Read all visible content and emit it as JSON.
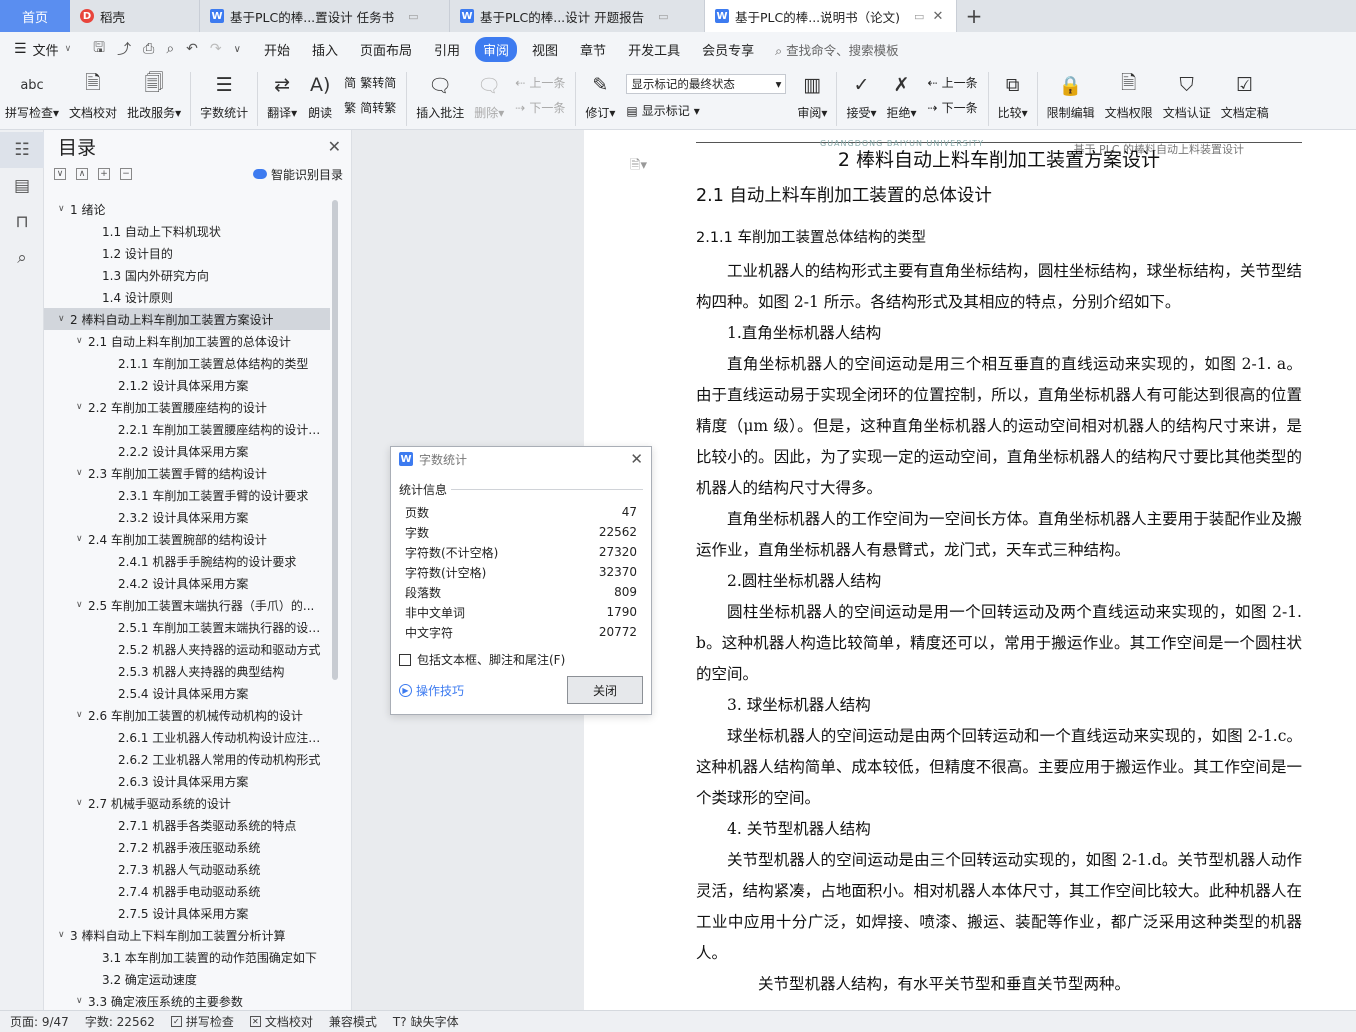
{
  "tabs": {
    "home": "首页",
    "items": [
      {
        "icon": "daoke-logo",
        "label": "稻壳"
      },
      {
        "icon": "wps-writer-logo",
        "label": "基于PLC的棒...置设计 任务书"
      },
      {
        "icon": "wps-writer-logo",
        "label": "基于PLC的棒...设计 开题报告"
      },
      {
        "icon": "wps-writer-logo",
        "label": "基于PLC的棒...说明书（论文)"
      }
    ]
  },
  "menu": {
    "file": "文件",
    "items": [
      "开始",
      "插入",
      "页面布局",
      "引用",
      "审阅",
      "视图",
      "章节",
      "开发工具",
      "会员专享"
    ],
    "active": "审阅",
    "search": "查找命令、搜索模板"
  },
  "ribbon": {
    "spell_ic": "abc",
    "spell": "拼写检查",
    "proofread": "文档校对",
    "batch": "批改服务",
    "wordcount": "字数统计",
    "translate": "翻译",
    "read": "朗读",
    "trad": "繁转简",
    "simp": "简转繁",
    "insert_comment": "插入批注",
    "delete": "删除",
    "prev_comment": "上一条",
    "next_comment": "下一条",
    "revise": "修订",
    "show_final": "显示标记的最终状态",
    "show_marks": "显示标记",
    "review": "审阅",
    "accept": "接受",
    "reject": "拒绝",
    "prev": "上一条",
    "next": "下一条",
    "compare": "比较",
    "restrict": "限制编辑",
    "doc_rights": "文档权限",
    "doc_cert": "文档认证",
    "doc_final": "文档定稿"
  },
  "toc": {
    "title": "目录",
    "ai": "智能识别目录",
    "items": [
      {
        "level": 1,
        "arrow": "∨",
        "text": "1  绪论"
      },
      {
        "level": 2,
        "arrow": "",
        "text": "1.1 自动上下料机现状"
      },
      {
        "level": 2,
        "arrow": "",
        "text": "1.2 设计目的"
      },
      {
        "level": 2,
        "arrow": "",
        "text": "1.3  国内外研究方向"
      },
      {
        "level": 2,
        "arrow": "",
        "text": "1.4  设计原则"
      },
      {
        "level": 1,
        "arrow": "∨",
        "text": "2  棒料自动上料车削加工装置方案设计",
        "selected": true
      },
      {
        "level": 2,
        "arrow": "∨",
        "text": "2.1 自动上料车削加工装置的总体设计"
      },
      {
        "level": 3,
        "arrow": "",
        "text": "2.1.1  车削加工装置总体结构的类型"
      },
      {
        "level": 3,
        "arrow": "",
        "text": "2.1.2  设计具体采用方案"
      },
      {
        "level": 2,
        "arrow": "∨",
        "text": "2.2  车削加工装置腰座结构的设计"
      },
      {
        "level": 3,
        "arrow": "",
        "text": "2.2.1  车削加工装置腰座结构的设计要..."
      },
      {
        "level": 3,
        "arrow": "",
        "text": "2.2.2  设计具体采用方案"
      },
      {
        "level": 2,
        "arrow": "∨",
        "text": "2.3  车削加工装置手臂的结构设计"
      },
      {
        "level": 3,
        "arrow": "",
        "text": "2.3.1  车削加工装置手臂的设计要求"
      },
      {
        "level": 3,
        "arrow": "",
        "text": "2.3.2  设计具体采用方案"
      },
      {
        "level": 2,
        "arrow": "∨",
        "text": "2.4  车削加工装置腕部的结构设计"
      },
      {
        "level": 3,
        "arrow": "",
        "text": "2.4.1  机器手手腕结构的设计要求"
      },
      {
        "level": 3,
        "arrow": "",
        "text": "2.4.2 设计具体采用方案"
      },
      {
        "level": 2,
        "arrow": "∨",
        "text": "2.5 车削加工装置末端执行器（手爪）的..."
      },
      {
        "level": 3,
        "arrow": "",
        "text": "2.5.1 车削加工装置末端执行器的设计..."
      },
      {
        "level": 3,
        "arrow": "",
        "text": "2.5.2 机器人夹持器的运动和驱动方式"
      },
      {
        "level": 3,
        "arrow": "",
        "text": "2.5.3  机器人夹持器的典型结构"
      },
      {
        "level": 3,
        "arrow": "",
        "text": "2.5.4  设计具体采用方案"
      },
      {
        "level": 2,
        "arrow": "∨",
        "text": "2.6 车削加工装置的机械传动机构的设计"
      },
      {
        "level": 3,
        "arrow": "",
        "text": "2.6.1 工业机器人传动机构设计应注意..."
      },
      {
        "level": 3,
        "arrow": "",
        "text": "2.6.2 工业机器人常用的传动机构形式"
      },
      {
        "level": 3,
        "arrow": "",
        "text": "2.6.3  设计具体采用方案"
      },
      {
        "level": 2,
        "arrow": "∨",
        "text": "2.7 机械手驱动系统的设计"
      },
      {
        "level": 3,
        "arrow": "",
        "text": "2.7.1 机器手各类驱动系统的特点"
      },
      {
        "level": 3,
        "arrow": "",
        "text": "2.7.2 机器手液压驱动系统"
      },
      {
        "level": 3,
        "arrow": "",
        "text": "2.7.3  机器人气动驱动系统"
      },
      {
        "level": 3,
        "arrow": "",
        "text": "2.7.4 机器手电动驱动系统"
      },
      {
        "level": 3,
        "arrow": "",
        "text": "2.7.5 设计具体采用方案"
      },
      {
        "level": 1,
        "arrow": "∨",
        "text": "3  棒料自动上下料车削加工装置分析计算"
      },
      {
        "level": 2,
        "arrow": "",
        "text": "3.1 本车削加工装置的动作范围确定如下"
      },
      {
        "level": 2,
        "arrow": "",
        "text": "3.2 确定运动速度"
      },
      {
        "level": 2,
        "arrow": "∨",
        "text": "3.3 确定液压系统的主要参数"
      }
    ]
  },
  "document": {
    "header_logo": "GUANGDONG BAIYUN UNIVERSITY",
    "header_text": "基于 PLC 的棒料自动上料装置设计",
    "h1": "2  棒料自动上料车削加工装置方案设计",
    "h2": "2.1 自动上料车削加工装置的总体设计",
    "h3": "2.1.1  车削加工装置总体结构的类型",
    "p1": "工业机器人的结构形式主要有直角坐标结构，圆柱坐标结构，球坐标结构，关节型结构四种。如图 2-1 所示。各结构形式及其相应的特点，分别介绍如下。",
    "s1": "1.直角坐标机器人结构",
    "p2": "直角坐标机器人的空间运动是用三个相互垂直的直线运动来实现的，如图 2-1. a。由于直线运动易于实现全闭环的位置控制，所以，直角坐标机器人有可能达到很高的位置精度（μm 级）。但是，这种直角坐标机器人的运动空间相对机器人的结构尺寸来讲，是比较小的。因此，为了实现一定的运动空间，直角坐标机器人的结构尺寸要比其他类型的机器人的结构尺寸大得多。",
    "p3": "直角坐标机器人的工作空间为一空间长方体。直角坐标机器人主要用于装配作业及搬运作业，直角坐标机器人有悬臂式，龙门式，天车式三种结构。",
    "s2": "2.圆柱坐标机器人结构",
    "p4": "圆柱坐标机器人的空间运动是用一个回转运动及两个直线运动来实现的，如图 2-1.b。这种机器人构造比较简单，精度还可以，常用于搬运作业。其工作空间是一个圆柱状的空间。",
    "s3": "3.  球坐标机器人结构",
    "p5": "球坐标机器人的空间运动是由两个回转运动和一个直线运动来实现的，如图 2-1.c。这种机器人结构简单、成本较低，但精度不很高。主要应用于搬运作业。其工作空间是一个类球形的空间。",
    "s4": "4.  关节型机器人结构",
    "p6": "关节型机器人的空间运动是由三个回转运动实现的，如图 2-1.d。关节型机器人动作灵活，结构紧凑，占地面积小。相对机器人本体尺寸，其工作空间比较大。此种机器人在工业中应用十分广泛，如焊接、喷漆、搬运、装配等作业，都广泛采用这种类型的机器人。",
    "p7": "关节型机器人结构，有水平关节型和垂直关节型两种。"
  },
  "dialog": {
    "title": "字数统计",
    "group": "统计信息",
    "stats": [
      {
        "label": "页数",
        "value": "47"
      },
      {
        "label": "字数",
        "value": "22562"
      },
      {
        "label": "字符数(不计空格)",
        "value": "27320"
      },
      {
        "label": "字符数(计空格)",
        "value": "32370"
      },
      {
        "label": "段落数",
        "value": "809"
      },
      {
        "label": "非中文单词",
        "value": "1790"
      },
      {
        "label": "中文字符",
        "value": "20772"
      }
    ],
    "checkbox": "包括文本框、脚注和尾注(F)",
    "tips": "操作技巧",
    "close": "关闭"
  },
  "status": {
    "page": "页面: 9/47",
    "words": "字数: 22562",
    "spell": "拼写检查",
    "proof": "文档校对",
    "compat": "兼容模式",
    "missing_font": "缺失字体"
  },
  "colors": {
    "accent": "#3d7bf0",
    "home_tab": "#5a8ef0",
    "daoke": "#e8453c"
  }
}
